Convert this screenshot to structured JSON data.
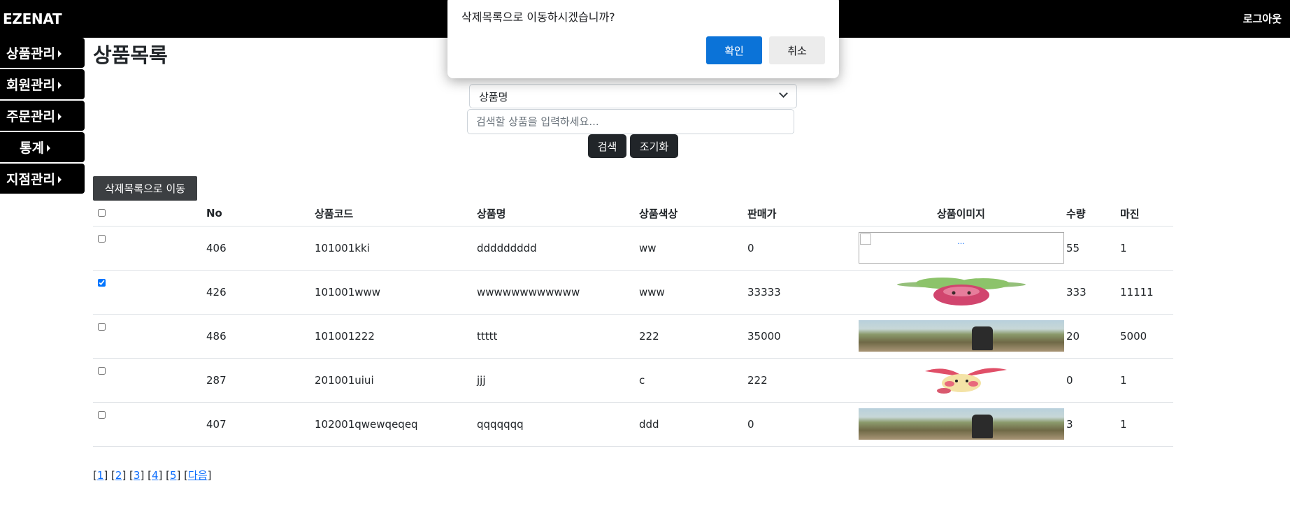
{
  "header": {
    "brand": "EZENAT",
    "logout_label": "로그아웃"
  },
  "sidebar": {
    "items": [
      {
        "label": "상품관리"
      },
      {
        "label": "회원관리"
      },
      {
        "label": "주문관리"
      },
      {
        "label": "통계"
      },
      {
        "label": "지점관리"
      }
    ]
  },
  "main": {
    "title": "상품목록"
  },
  "search": {
    "select_value": "상품명",
    "placeholder": "검색할 상품을 입력하세요...",
    "search_label": "검색",
    "reset_label": "조기화"
  },
  "trash_button_label": "삭제목록으로 이동",
  "table": {
    "headers": {
      "no": "No",
      "code": "상품코드",
      "name": "상품명",
      "color": "상품색상",
      "price": "판매가",
      "image": "상품이미지",
      "qty": "수량",
      "margin": "마진"
    },
    "rows": [
      {
        "checked": false,
        "no": "406",
        "code": "101001kki",
        "name": "ddddddddd",
        "color": "ww",
        "price": "0",
        "image": "broken-image",
        "image_alt": "...",
        "qty": "55",
        "margin": "1"
      },
      {
        "checked": true,
        "no": "426",
        "code": "101001www",
        "name": "wwwwwwwwwwww",
        "color": "www",
        "price": "33333",
        "image": "pink-pokemon-green-leaves",
        "qty": "333",
        "margin": "11111"
      },
      {
        "checked": false,
        "no": "486",
        "code": "101001222",
        "name": "ttttt",
        "color": "222",
        "price": "35000",
        "image": "outdoor-photo",
        "qty": "20",
        "margin": "5000"
      },
      {
        "checked": false,
        "no": "287",
        "code": "201001uiui",
        "name": "jjj",
        "color": "c",
        "price": "222",
        "image": "pink-yellow-pokemon",
        "qty": "0",
        "margin": "1"
      },
      {
        "checked": false,
        "no": "407",
        "code": "102001qwewqeqeq",
        "name": "qqqqqqq",
        "color": "ddd",
        "price": "0",
        "image": "outdoor-photo",
        "qty": "3",
        "margin": "1"
      }
    ]
  },
  "pagination": {
    "pages": [
      "1",
      "2",
      "3",
      "4",
      "5"
    ],
    "next_label": "다음"
  },
  "dialog": {
    "message": "삭제목록으로 이동하시겠습니까?",
    "ok_label": "확인",
    "cancel_label": "취소"
  },
  "colors": {
    "topbar": "#000000",
    "dark_button": "#212529",
    "dialog_ok": "#0b73d8",
    "link": "#0d6efd"
  }
}
